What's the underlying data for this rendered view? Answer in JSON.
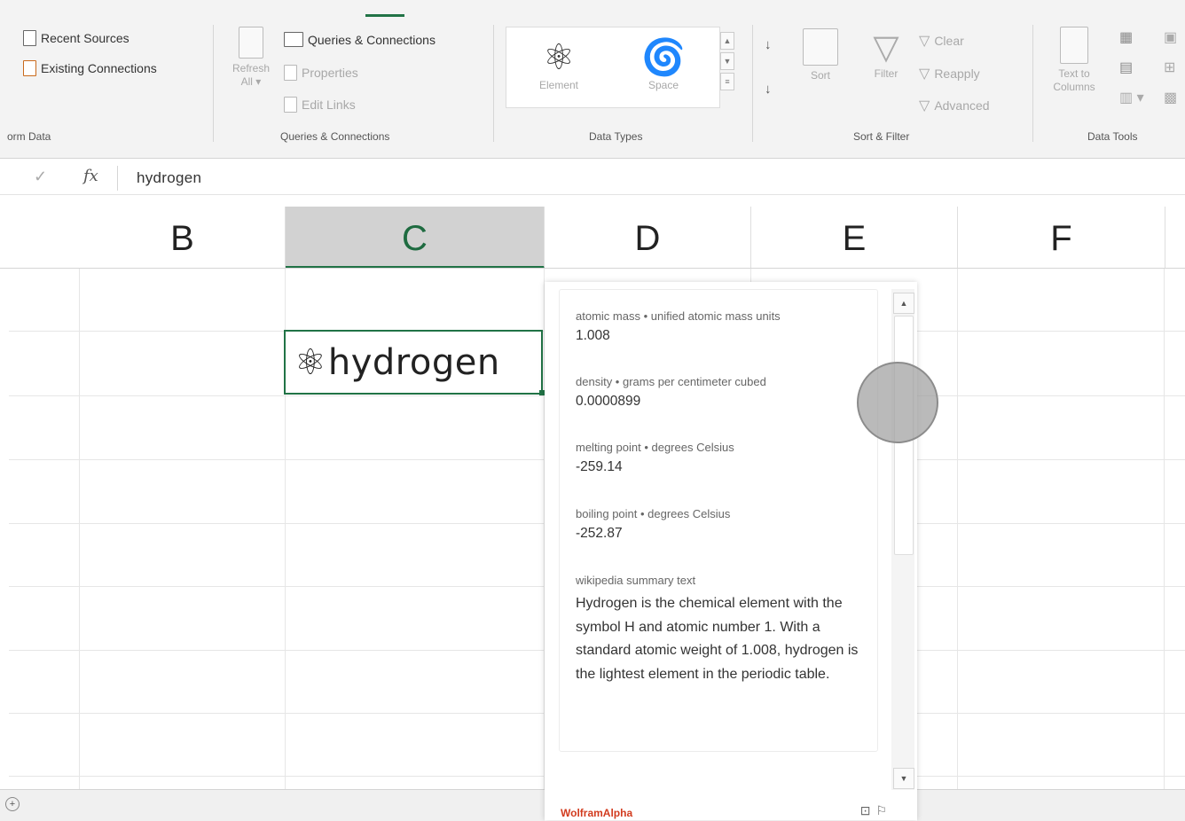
{
  "ribbon": {
    "get_transform": {
      "recent_sources": "Recent Sources",
      "existing_connections": "Existing Connections",
      "group_label": "orm Data"
    },
    "queries": {
      "refresh_label": "Refresh",
      "refresh_sub": "All ▾",
      "queries_connections": "Queries & Connections",
      "properties": "Properties",
      "edit_links": "Edit Links",
      "group_label": "Queries & Connections"
    },
    "data_types": {
      "element": "Element",
      "space": "Space",
      "group_label": "Data Types"
    },
    "sort_filter": {
      "sort": "Sort",
      "filter": "Filter",
      "clear": "Clear",
      "reapply": "Reapply",
      "advanced": "Advanced",
      "group_label": "Sort & Filter"
    },
    "data_tools": {
      "text_to_columns_1": "Text to",
      "text_to_columns_2": "Columns",
      "group_label": "Data Tools"
    }
  },
  "formula_bar": {
    "value": "hydrogen",
    "fx": "fx",
    "check": "✓"
  },
  "columns": [
    "B",
    "C",
    "D",
    "E",
    "F"
  ],
  "active_cell": {
    "text": "hydrogen",
    "icon": "atom-icon"
  },
  "card": {
    "fields": [
      {
        "label": "atomic mass • unified atomic mass units",
        "value": "1.008"
      },
      {
        "label": "density • grams per centimeter cubed",
        "value": "0.0000899"
      },
      {
        "label": "melting point • degrees Celsius",
        "value": "-259.14"
      },
      {
        "label": "boiling point • degrees Celsius",
        "value": "-252.87"
      }
    ],
    "summary_label": "wikipedia summary text",
    "summary": "Hydrogen is the chemical element with the symbol H and atomic number 1. With a standard atomic weight of 1.008, hydrogen is the lightest element in the periodic table.",
    "footer_brand": "WolframAlpha"
  },
  "colors": {
    "accent": "#217346",
    "brand": "#d23b1e"
  }
}
